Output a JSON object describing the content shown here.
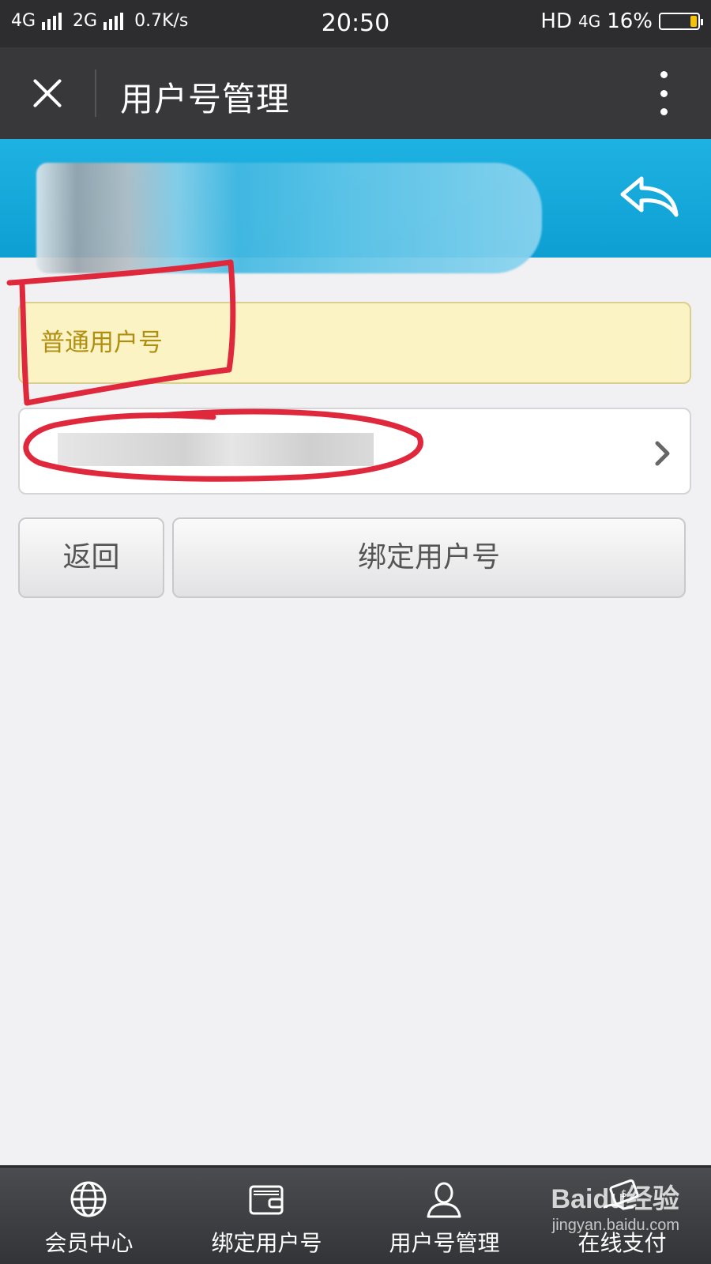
{
  "status_bar": {
    "network_left": "4G",
    "network_mid": "2G",
    "speed": "0.7K/s",
    "time": "20:50",
    "hd": "HD",
    "network_right": "4G",
    "battery": "16%",
    "battery_color": "#f4c20d"
  },
  "header": {
    "title": "用户号管理",
    "close_icon": "close-icon",
    "more_icon": "more-vertical-icon"
  },
  "banner": {
    "color": "#1eb2e2",
    "back_icon": "reply-arrow-icon"
  },
  "account": {
    "type_label": "普通用户号"
  },
  "buttons": {
    "back_label": "返回",
    "bind_label": "绑定用户号"
  },
  "bottom_nav": {
    "items": [
      {
        "label": "会员中心",
        "icon": "globe-icon"
      },
      {
        "label": "绑定用户号",
        "icon": "wallet-icon"
      },
      {
        "label": "用户号管理",
        "icon": "user-icon"
      },
      {
        "label": "在线支付",
        "icon": "payment-icon"
      }
    ]
  },
  "watermark": {
    "logo": "Baidu经验",
    "url": "jingyan.baidu.com"
  },
  "annotation_color": "#e0283c"
}
